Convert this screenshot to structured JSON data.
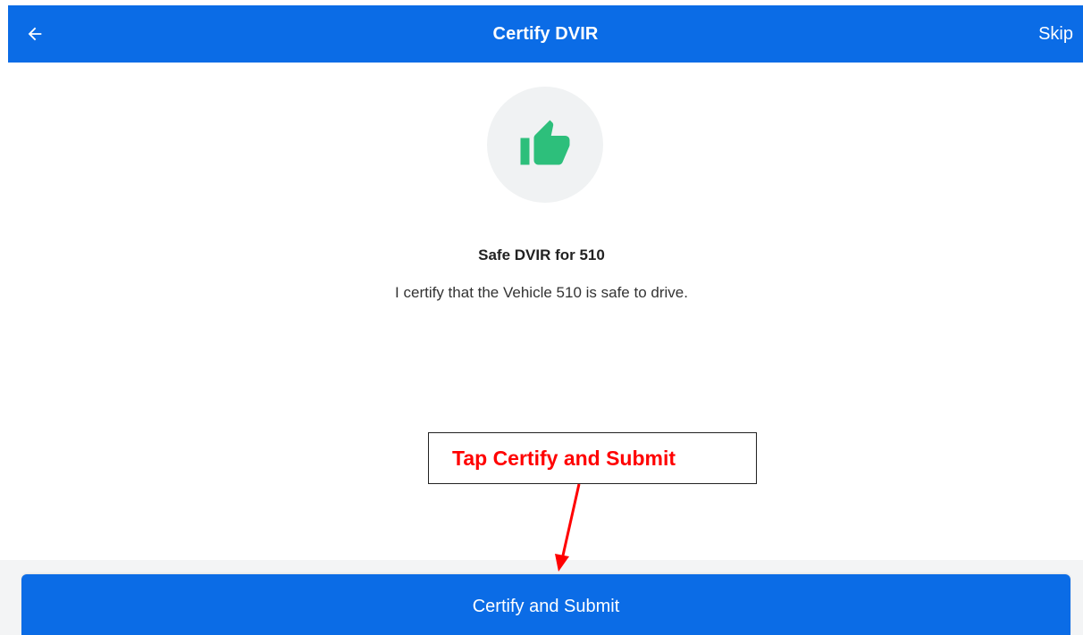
{
  "app_bar": {
    "title": "Certify DVIR",
    "skip_label": "Skip",
    "back_icon": "arrow-left-icon"
  },
  "status": {
    "icon": "thumbs-up-icon",
    "heading": "Safe DVIR for 510",
    "message": "I certify that the Vehicle 510 is safe to drive."
  },
  "annotation": {
    "text": "Tap Certify and Submit"
  },
  "footer": {
    "submit_label": "Certify and Submit"
  },
  "colors": {
    "primary": "#0b6ce6",
    "thumb": "#2dbf7b",
    "annotation": "#ff0000"
  }
}
